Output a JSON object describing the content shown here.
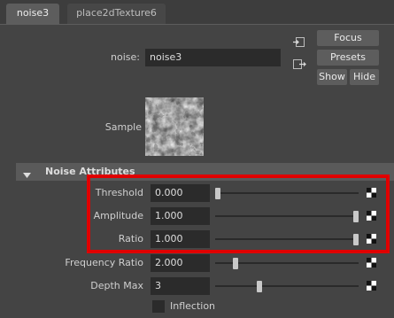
{
  "tabs": [
    {
      "label": "noise3",
      "active": true
    },
    {
      "label": "place2dTexture6",
      "active": false
    }
  ],
  "node": {
    "type_label": "noise:",
    "name_value": "noise3"
  },
  "buttons": {
    "focus": "Focus",
    "presets": "Presets",
    "show": "Show",
    "hide": "Hide"
  },
  "sample_label": "Sample",
  "section": {
    "title": "Noise Attributes",
    "expanded": true
  },
  "attributes": [
    {
      "label": "Threshold",
      "value": "0.000",
      "slider_fraction": 0.0
    },
    {
      "label": "Amplitude",
      "value": "1.000",
      "slider_fraction": 1.0
    },
    {
      "label": "Ratio",
      "value": "1.000",
      "slider_fraction": 1.0
    },
    {
      "label": "Frequency Ratio",
      "value": "2.000",
      "slider_fraction": 0.125
    },
    {
      "label": "Depth Max",
      "value": "3",
      "slider_fraction": 0.3
    }
  ],
  "inflection": {
    "label": "Inflection",
    "checked": false
  },
  "colors": {
    "highlight": "#e00000",
    "background": "#444444",
    "field": "#2b2b2b"
  }
}
